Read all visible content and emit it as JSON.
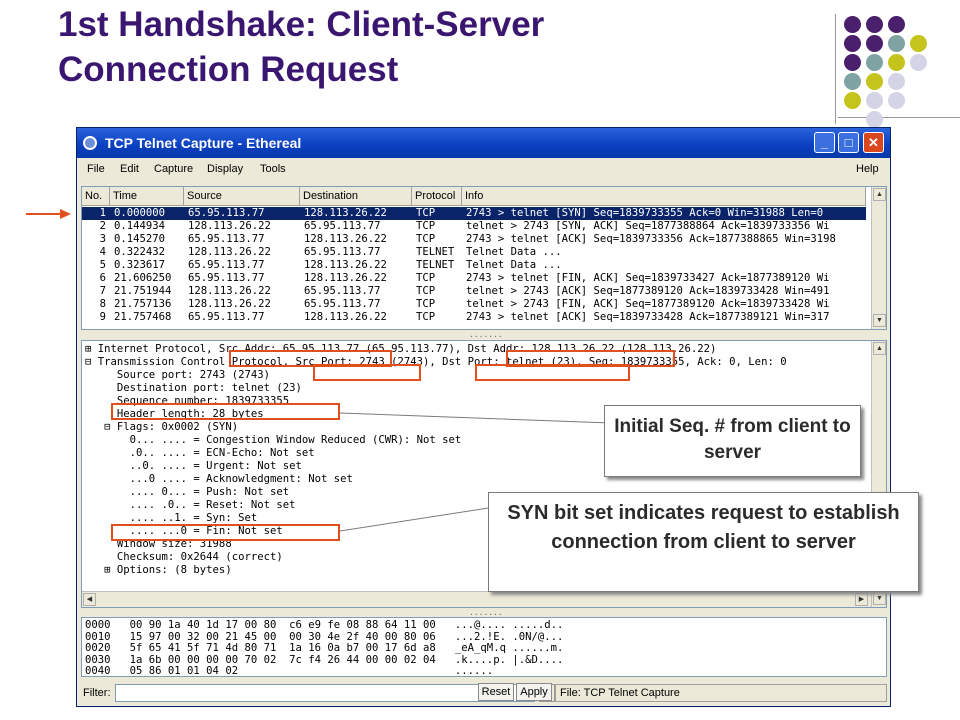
{
  "slide": {
    "title_line1": "1st Handshake:  Client-Server",
    "title_line2": "Connection Request"
  },
  "colors": {
    "title": "#3a1670",
    "highlight_box": "#e0501c",
    "selection": "#0a246a",
    "deco_purple": "#4a1f6b",
    "deco_teal": "#7fa3a3",
    "deco_lime": "#c4c41c",
    "deco_lavender": "#d4d4e6"
  },
  "window": {
    "title": "TCP Telnet Capture - Ethereal",
    "minimize_icon": "minimize-icon",
    "maximize_icon": "maximize-icon",
    "close_icon": "close-icon"
  },
  "menu": [
    "File",
    "Edit",
    "Capture",
    "Display",
    "Tools",
    "Help"
  ],
  "packet_list": {
    "columns": [
      "No.",
      "Time",
      "Source",
      "Destination",
      "Protocol",
      "Info"
    ],
    "rows": [
      {
        "no": "1",
        "time": "0.000000",
        "src": "65.95.113.77",
        "dst": "128.113.26.22",
        "proto": "TCP",
        "info": "2743 > telnet [SYN] Seq=1839733355 Ack=0 Win=31988 Len=0"
      },
      {
        "no": "2",
        "time": "0.144934",
        "src": "128.113.26.22",
        "dst": "65.95.113.77",
        "proto": "TCP",
        "info": "telnet > 2743 [SYN, ACK] Seq=1877388864 Ack=1839733356 Wi"
      },
      {
        "no": "3",
        "time": "0.145270",
        "src": "65.95.113.77",
        "dst": "128.113.26.22",
        "proto": "TCP",
        "info": "2743 > telnet [ACK] Seq=1839733356 Ack=1877388865 Win=3198"
      },
      {
        "no": "4",
        "time": "0.322432",
        "src": "128.113.26.22",
        "dst": "65.95.113.77",
        "proto": "TELNET",
        "info": "Telnet Data ..."
      },
      {
        "no": "5",
        "time": "0.323617",
        "src": "65.95.113.77",
        "dst": "128.113.26.22",
        "proto": "TELNET",
        "info": "Telnet Data ..."
      },
      {
        "no": "6",
        "time": "21.606250",
        "src": "65.95.113.77",
        "dst": "128.113.26.22",
        "proto": "TCP",
        "info": "2743 > telnet [FIN, ACK] Seq=1839733427 Ack=1877389120 Wi"
      },
      {
        "no": "7",
        "time": "21.751944",
        "src": "128.113.26.22",
        "dst": "65.95.113.77",
        "proto": "TCP",
        "info": "telnet > 2743 [ACK] Seq=1877389120 Ack=1839733428 Win=491"
      },
      {
        "no": "8",
        "time": "21.757136",
        "src": "128.113.26.22",
        "dst": "65.95.113.77",
        "proto": "TCP",
        "info": "telnet > 2743 [FIN, ACK] Seq=1877389120 Ack=1839733428 Wi"
      },
      {
        "no": "9",
        "time": "21.757468",
        "src": "65.95.113.77",
        "dst": "128.113.26.22",
        "proto": "TCP",
        "info": "2743 > telnet [ACK] Seq=1839733428 Ack=1877389121 Win=317"
      }
    ]
  },
  "detail_tree": [
    "⊞ Internet Protocol, Src Addr: 65.95.113.77 (65.95.113.77), Dst Addr: 128.113.26.22 (128.113.26.22)",
    "⊟ Transmission Control Protocol, Src Port: 2743 (2743), Dst Port: telnet (23), Seq: 1839733355, Ack: 0, Len: 0",
    "     Source port: 2743 (2743)",
    "     Destination port: telnet (23)",
    "     Sequence number: 1839733355",
    "     Header length: 28 bytes",
    "   ⊟ Flags: 0x0002 (SYN)",
    "       0... .... = Congestion Window Reduced (CWR): Not set",
    "       .0.. .... = ECN-Echo: Not set",
    "       ..0. .... = Urgent: Not set",
    "       ...0 .... = Acknowledgment: Not set",
    "       .... 0... = Push: Not set",
    "       .... .0.. = Reset: Not set",
    "       .... ..1. = Syn: Set",
    "       .... ...0 = Fin: Not set",
    "     Window size: 31988",
    "     Checksum: 0x2644 (correct)",
    "   ⊞ Options: (8 bytes)"
  ],
  "hex_dump": [
    "0000   00 90 1a 40 1d 17 00 80  c6 e9 fe 08 88 64 11 00   ...@.... .....d..",
    "0010   15 97 00 32 00 21 45 00  00 30 4e 2f 40 00 80 06   ...2.!E. .0N/@...",
    "0020   5f 65 41 5f 71 4d 80 71  1a 16 0a b7 00 17 6d a8   _eA_qM.q ......m.",
    "0030   1a 6b 00 00 00 00 70 02  7c f4 26 44 00 00 02 04   .k....p. |.&D....",
    "0040   05 86 01 01 04 02                                  ......"
  ],
  "callouts": {
    "seq_text": "Initial Seq. # from client to server",
    "syn_text": "SYN bit set indicates request to establish connection from client to server"
  },
  "statusbar": {
    "filter_label": "Filter:",
    "filter_value": "",
    "slash_label": "/",
    "reset_label": "Reset",
    "apply_label": "Apply",
    "file_text": "File: TCP Telnet Capture"
  }
}
